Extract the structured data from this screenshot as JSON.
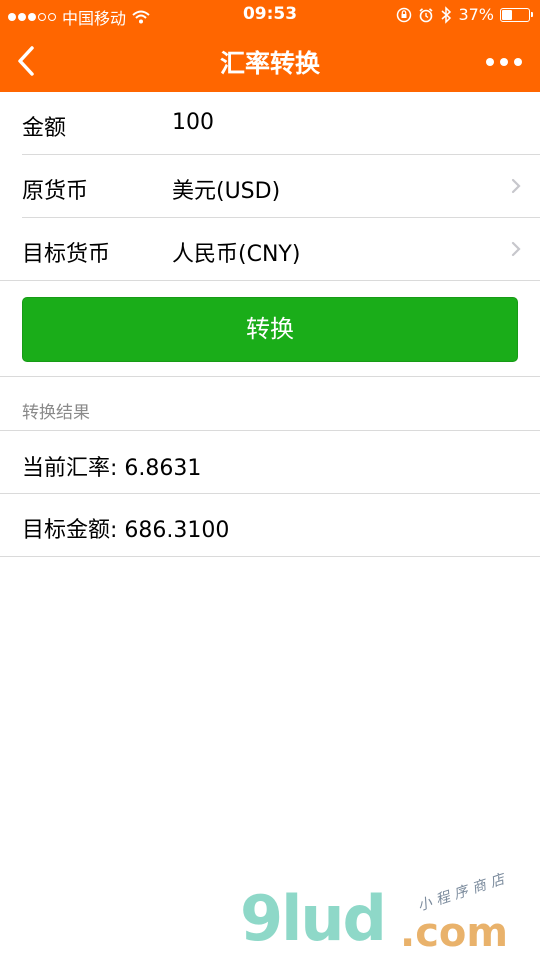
{
  "status_bar": {
    "carrier": "中国移动",
    "time": "09:53",
    "battery_percent": "37%",
    "battery_level": 0.37,
    "icons": [
      "signal-dots-icon",
      "wifi-icon",
      "lock-rotation-icon",
      "alarm-icon",
      "bluetooth-icon",
      "battery-icon"
    ]
  },
  "nav": {
    "title": "汇率转换",
    "back_icon": "chevron-left-icon",
    "more_icon": "more-dots-icon"
  },
  "form": {
    "amount_label": "金额",
    "amount_value": "100",
    "source_label": "原货币",
    "source_value": "美元(USD)",
    "target_label": "目标货币",
    "target_value": "人民币(CNY)"
  },
  "convert_button": "转换",
  "result": {
    "section_title": "转换结果",
    "rate_text": "当前汇率: 6.8631",
    "amount_text": "目标金额: 686.3100"
  },
  "watermark": {
    "logo": "9lud",
    "domain": ".com",
    "tagline": "小程序商店"
  },
  "colors": {
    "brand": "#FF6600",
    "button": "#1AAD19",
    "divider": "#DADADA"
  }
}
